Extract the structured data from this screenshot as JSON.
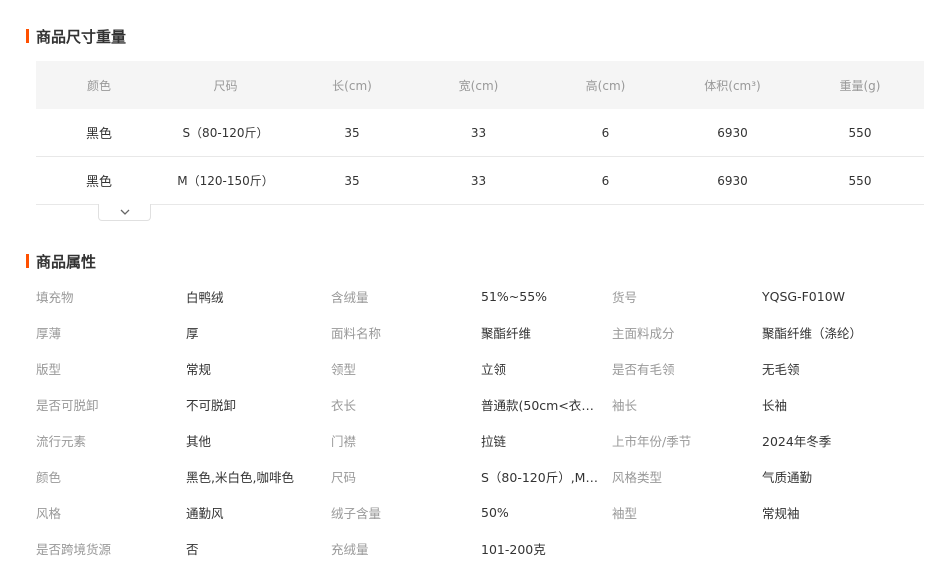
{
  "size_section": {
    "title": "商品尺寸重量",
    "headers": [
      "颜色",
      "尺码",
      "长(cm)",
      "宽(cm)",
      "高(cm)",
      "体积(cm³)",
      "重量(g)"
    ],
    "rows": [
      [
        "黑色",
        "S（80-120斤）",
        "35",
        "33",
        "6",
        "6930",
        "550"
      ],
      [
        "黑色",
        "M（120-150斤）",
        "35",
        "33",
        "6",
        "6930",
        "550"
      ]
    ],
    "expand_icon": "chevron-down-icon",
    "accent_color": "#ff5000"
  },
  "attr_section": {
    "title": "商品属性",
    "rows": [
      [
        [
          "填充物",
          "白鸭绒"
        ],
        [
          "含绒量",
          "51%~55%"
        ],
        [
          "货号",
          "YQSG-F010W"
        ]
      ],
      [
        [
          "厚薄",
          "厚"
        ],
        [
          "面料名称",
          "聚酯纤维"
        ],
        [
          "主面料成分",
          "聚酯纤维（涤纶）"
        ]
      ],
      [
        [
          "版型",
          "常规"
        ],
        [
          "领型",
          "立领"
        ],
        [
          "是否有毛领",
          "无毛领"
        ]
      ],
      [
        [
          "是否可脱卸",
          "不可脱卸"
        ],
        [
          "衣长",
          "普通款(50cm<衣长≤..."
        ],
        [
          "袖长",
          "长袖"
        ]
      ],
      [
        [
          "流行元素",
          "其他"
        ],
        [
          "门襟",
          "拉链"
        ],
        [
          "上市年份/季节",
          "2024年冬季"
        ]
      ],
      [
        [
          "颜色",
          "黑色,米白色,咖啡色"
        ],
        [
          "尺码",
          "S（80-120斤）,M（1..."
        ],
        [
          "风格类型",
          "气质通勤"
        ]
      ],
      [
        [
          "风格",
          "通勤风"
        ],
        [
          "绒子含量",
          "50%"
        ],
        [
          "袖型",
          "常规袖"
        ]
      ],
      [
        [
          "是否跨境货源",
          "否"
        ],
        [
          "充绒量",
          "101-200克"
        ]
      ]
    ]
  }
}
